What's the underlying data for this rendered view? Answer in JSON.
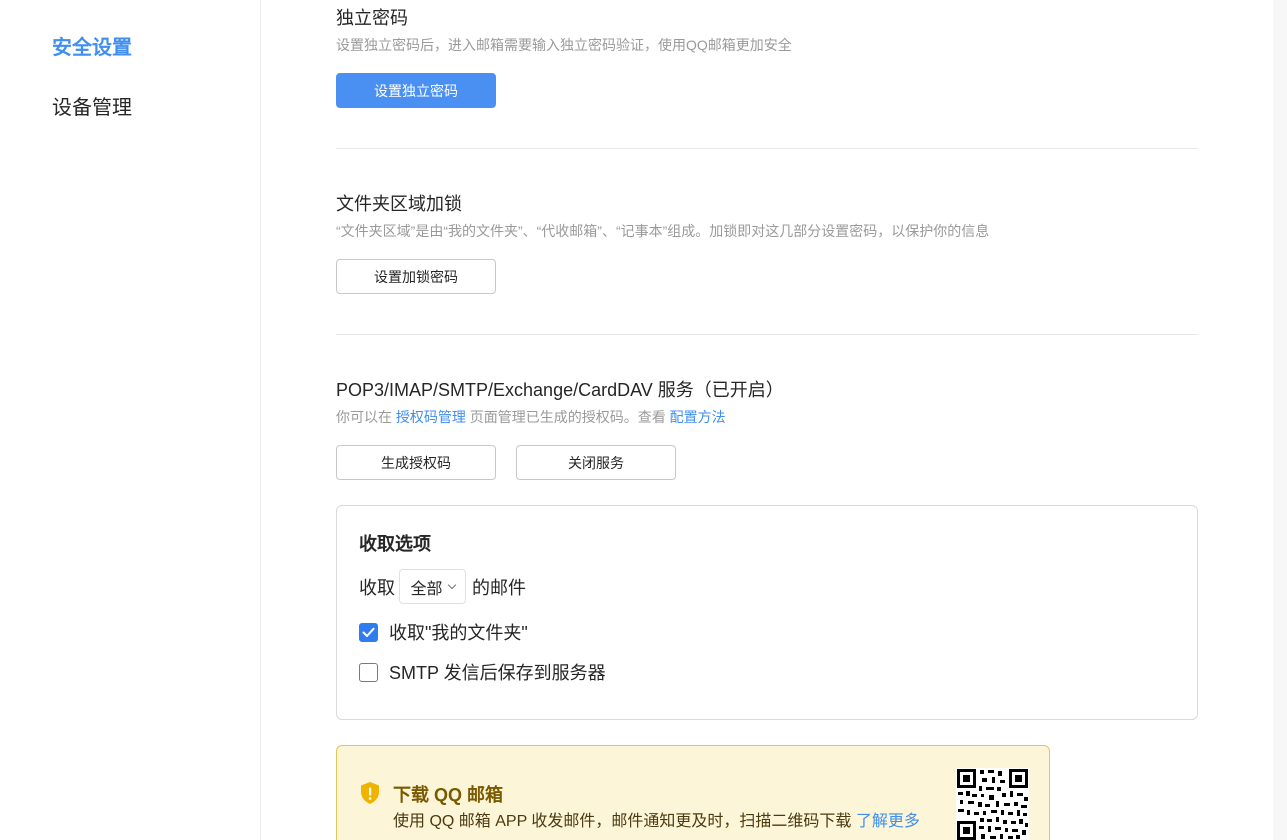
{
  "sidebar": {
    "items": [
      {
        "label": "安全设置",
        "active": true
      },
      {
        "label": "设备管理",
        "active": false
      }
    ]
  },
  "sections": {
    "independent_password": {
      "title": "独立密码",
      "desc": "设置独立密码后，进入邮箱需要输入独立密码验证，使用QQ邮箱更加安全",
      "button": "设置独立密码"
    },
    "folder_lock": {
      "title": "文件夹区域加锁",
      "desc": "“文件夹区域”是由“我的文件夹”、“代收邮箱”、“记事本”组成。加锁即对这几部分设置密码，以保护你的信息",
      "button": "设置加锁密码"
    },
    "pop3": {
      "title": "POP3/IMAP/SMTP/Exchange/CardDAV 服务（已开启）",
      "desc_prefix": "你可以在",
      "desc_link1": "授权码管理",
      "desc_middle": "页面管理已生成的授权码。查看",
      "desc_link2": "配置方法",
      "button_generate": "生成授权码",
      "button_close": "关闭服务"
    }
  },
  "receive_options": {
    "title": "收取选项",
    "prefix": "收取",
    "select_value": "全部",
    "suffix": "的邮件",
    "checkbox1": {
      "label": "收取\"我的文件夹\"",
      "checked": true
    },
    "checkbox2": {
      "label": "SMTP 发信后保存到服务器",
      "checked": false
    }
  },
  "banner": {
    "title": "下载 QQ 邮箱",
    "desc": "使用 QQ 邮箱 APP 收发邮件，邮件通知更及时，扫描二维码下载",
    "link": "了解更多"
  },
  "colors": {
    "accent": "#3f8ef0",
    "primary_button": "#4a90f3",
    "banner_bg": "#fdf5d8",
    "banner_border": "#e6c45a"
  },
  "icons": [
    "checkmark-icon",
    "chevron-down-icon",
    "shield-icon",
    "qr-code-icon"
  ]
}
